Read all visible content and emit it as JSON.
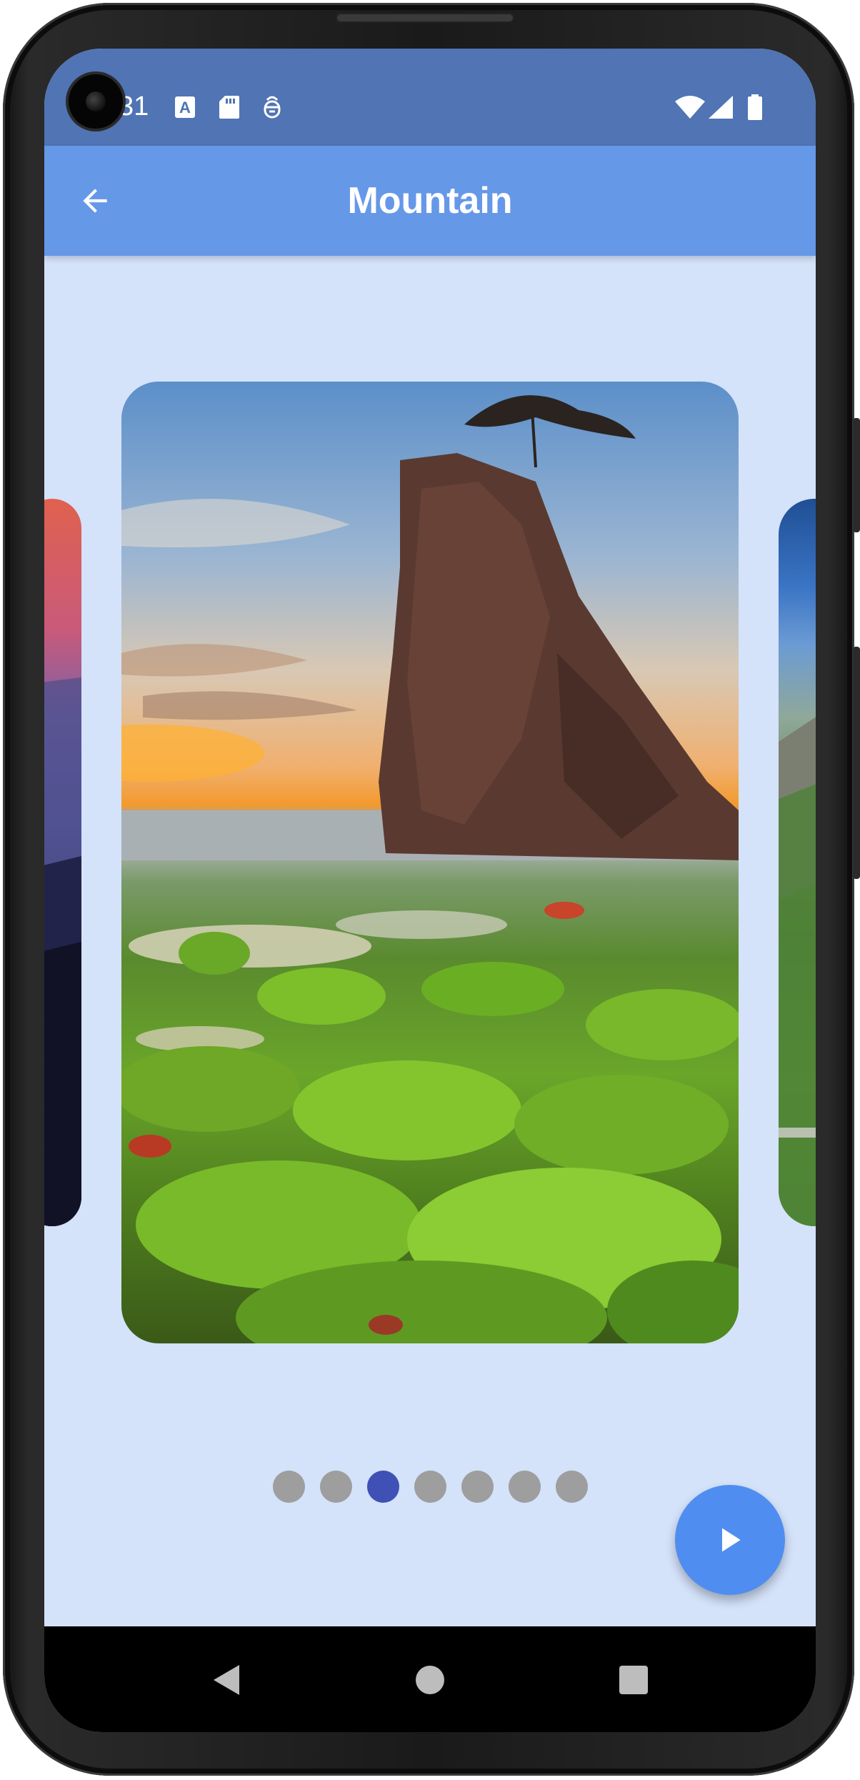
{
  "status_bar": {
    "time": "31",
    "left_icons": [
      "keyboard-a-icon",
      "sd-card-icon",
      "debug-icon"
    ],
    "right_icons": [
      "wifi-icon",
      "cell-signal-icon",
      "battery-icon"
    ]
  },
  "app_bar": {
    "title": "Mountain",
    "back_icon": "arrow-back-icon"
  },
  "carousel": {
    "current_index": 3,
    "total": 7,
    "images": [
      "sunset-mountain-photo",
      "sea-stack-mossy-rocks-photo",
      "green-valley-photo"
    ]
  },
  "fab": {
    "icon": "play-icon"
  },
  "nav_bar": {
    "buttons": [
      "back-triangle-icon",
      "home-circle-icon",
      "recents-square-icon"
    ]
  },
  "colors": {
    "status_bar": "#5074b4",
    "app_bar": "#6698e8",
    "background": "#d4e2fa",
    "dot_active": "#3f51b5",
    "dot_inactive": "#9e9e9e",
    "fab": "#4f8ef0"
  }
}
